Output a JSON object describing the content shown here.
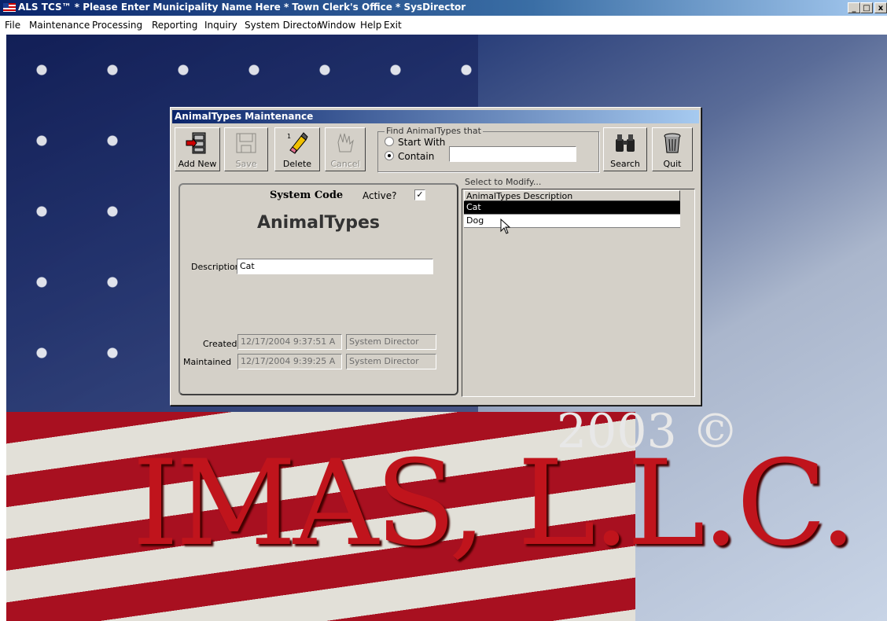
{
  "app": {
    "title": "ALS TCS™ * Please Enter Municipality Name Here * Town Clerk's Office * SysDirector",
    "window_buttons": [
      "_",
      "□",
      "x"
    ]
  },
  "menubar": {
    "items": [
      "File",
      "Maintenance",
      "Processing",
      "Reporting",
      "Inquiry",
      "System Director",
      "Window",
      "Help",
      "Exit"
    ]
  },
  "background": {
    "logo_text": "IMAS, L.L.C.",
    "year_text": "2003 ©"
  },
  "dialog": {
    "title": "AnimalTypes Maintenance",
    "toolbar": {
      "add_new": "Add New",
      "save": "Save",
      "delete": "Delete",
      "cancel": "Cancel",
      "search": "Search",
      "quit": "Quit"
    },
    "find": {
      "legend": "Find AnimalTypes that",
      "start_with": "Start With",
      "contain": "Contain",
      "selected": "Contain",
      "value": ""
    },
    "panel": {
      "system_code": "System Code",
      "active_label": "Active?",
      "active_checked": true,
      "active_mark": "✓",
      "heading": "AnimalTypes",
      "description_label": "Description",
      "description_value": "Cat",
      "created_label": "Created",
      "created_date": "12/17/2004 9:37:51 A",
      "created_by": "System Director",
      "maintained_label": "Maintained",
      "maintained_date": "12/17/2004 9:39:25 A",
      "maintained_by": "System Director"
    },
    "list": {
      "label": "Select to Modify...",
      "header": "AnimalTypes Description",
      "rows": [
        "Cat",
        "Dog"
      ],
      "selected": "Cat"
    }
  },
  "colors": {
    "title_bar": "#0a246a",
    "dialog_face": "#d4d0c8",
    "selection": "#000000",
    "logo_red": "#c0141c"
  }
}
